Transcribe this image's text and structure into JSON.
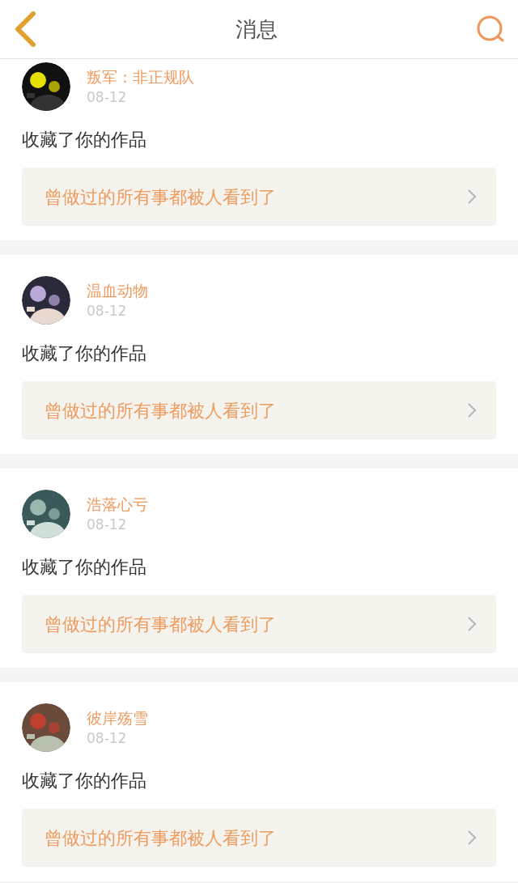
{
  "header": {
    "title": "消息"
  },
  "messages": [
    {
      "user": "叛军：非正规队",
      "date": "08-12",
      "action": "收藏了你的作品",
      "work": "曾做过的所有事都被人看到了"
    },
    {
      "user": "温血动物",
      "date": "08-12",
      "action": "收藏了你的作品",
      "work": "曾做过的所有事都被人看到了"
    },
    {
      "user": "浩落心亏",
      "date": "08-12",
      "action": "收藏了你的作品",
      "work": "曾做过的所有事都被人看到了"
    },
    {
      "user": "彼岸殇雪",
      "date": "08-12",
      "action": "收藏了你的作品",
      "work": "曾做过的所有事都被人看到了"
    }
  ]
}
